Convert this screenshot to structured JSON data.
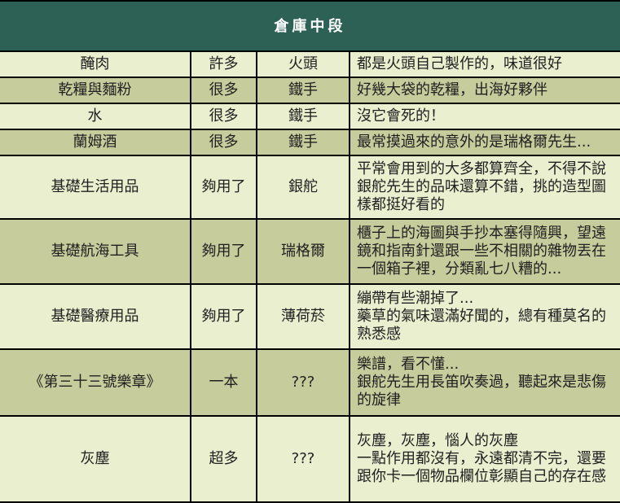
{
  "title": "倉庫中段",
  "colors": {
    "header_bg": "#2e6155",
    "row_light": "#e9efcf",
    "row_dark": "#c6cc9c",
    "text": "#1f1f1f"
  },
  "rows": [
    {
      "item": "醃肉",
      "qty": "許多",
      "owner": "火頭",
      "notes": "都是火頭自己製作的，味道很好"
    },
    {
      "item": "乾糧與麵粉",
      "qty": "很多",
      "owner": "鐵手",
      "notes": "好幾大袋的乾糧，出海好夥伴"
    },
    {
      "item": "水",
      "qty": "很多",
      "owner": "鐵手",
      "notes": "沒它會死的！"
    },
    {
      "item": "蘭姆酒",
      "qty": "很多",
      "owner": "鐵手",
      "notes": "最常摸過來的意外的是瑞格爾先生..."
    },
    {
      "item": "基礎生活用品",
      "qty": "夠用了",
      "owner": "銀舵",
      "notes": "平常會用到的大多都算齊全，不得不說銀舵先生的品味還算不錯，挑的造型圖樣都挺好看的"
    },
    {
      "item": "基礎航海工具",
      "qty": "夠用了",
      "owner": "瑞格爾",
      "notes": "櫃子上的海圖與手抄本塞得隨興，望遠鏡和指南針還跟一些不相關的雜物丟在一個箱子裡，分類亂七八糟的..."
    },
    {
      "item": "基礎醫療用品",
      "qty": "夠用了",
      "owner": "薄荷菸",
      "notes": "繃帶有些潮掉了...\n藥草的氣味還滿好聞的，總有種莫名的熟悉感"
    },
    {
      "item": "《第三十三號樂章》",
      "qty": "一本",
      "owner": "???",
      "notes": "樂譜，看不懂...\n銀舵先生用長笛吹奏過，聽起來是悲傷的旋律"
    },
    {
      "item": "灰塵",
      "qty": "超多",
      "owner": "???",
      "notes": "灰塵，灰塵，惱人的灰塵\n一點作用都沒有，永遠都清不完，還要跟你卡一個物品欄位彰顯自己的存在感"
    }
  ]
}
